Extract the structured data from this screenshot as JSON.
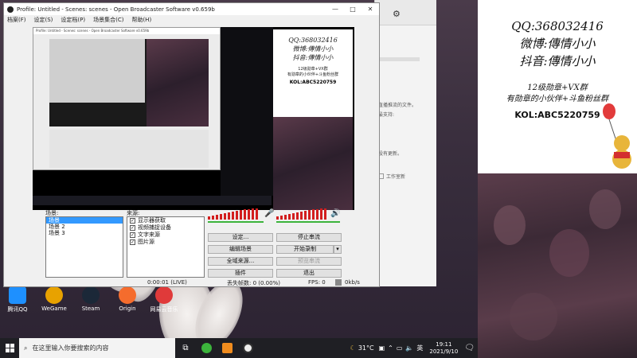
{
  "obs": {
    "title": "Profile: Untitled - Scenes: scenes - Open Broadcaster Software v0.659b",
    "menu": [
      "档案(F)",
      "设定(S)",
      "设定档(P)",
      "场景集合(C)",
      "帮助(H)"
    ],
    "window_controls": [
      "—",
      "□",
      "✕"
    ],
    "scenes_label": "场景:",
    "scenes": [
      "场景",
      "场景 2",
      "场景 3"
    ],
    "sources_label": "来源:",
    "sources": [
      "显示器获取",
      "视频捕捉设备",
      "文字来源",
      "图片源"
    ],
    "buttons": {
      "settings": "设定...",
      "stop_stream": "停止串流",
      "edit_scene": "编辑场景",
      "start_record": "开始录制",
      "global_sources": "全域来源...",
      "preview_stream": "预览串流",
      "plugins": "插件",
      "exit": "退出"
    },
    "status": {
      "time": "0:00:01 (LIVE)",
      "dropped": "丢失帧数: 0 (0.00%)",
      "fps": "FPS: 0",
      "bitrate": "0kb/s"
    }
  },
  "promo": {
    "qq": "QQ:368032416",
    "weibo": "微博:傳情小小",
    "douyin": "抖音:傳情小小",
    "line1": "12级勋章+VX群",
    "line2": "有勋章的小伙伴+斗鱼粉丝群",
    "kol": "KOL:ABC5220759"
  },
  "bgwin": {
    "text1": "直播推流的文件。",
    "text2": "最支持:",
    "text3": "没有更新。",
    "checkbox": "工作室新"
  },
  "desktop_icons": [
    {
      "label": "腾讯QQ",
      "color": "#1e90ff"
    },
    {
      "label": "WeGame",
      "color": "#e8a200"
    },
    {
      "label": "Steam",
      "color": "#1b2838"
    },
    {
      "label": "Origin",
      "color": "#f56c2d"
    },
    {
      "label": "网易云音乐",
      "color": "#e03a3a"
    }
  ],
  "taskbar": {
    "search_placeholder": "在这里输入你要搜索的内容",
    "weather": "31°C",
    "time": "19:11",
    "date": "2021/9/10",
    "ime": "英"
  },
  "colors": {
    "meter_red": "#d21e1e",
    "meter_green": "#3cb43c",
    "selection": "#3399ff"
  }
}
